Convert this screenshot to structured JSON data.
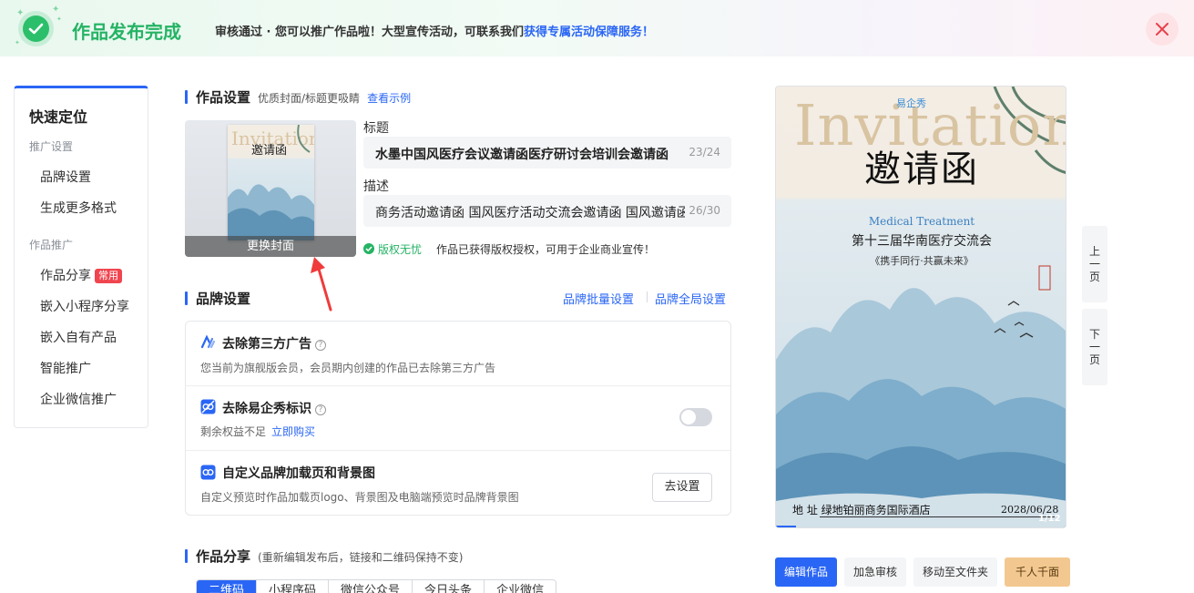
{
  "banner": {
    "title": "作品发布完成",
    "message": "审核通过 · 您可以推广作品啦！大型宣传活动，可联系我们",
    "message_link": "获得专属活动保障服务！"
  },
  "nav": {
    "title": "快速定位",
    "group1": "推广设置",
    "item_brand": "品牌设置",
    "item_formats": "生成更多格式",
    "group2": "作品推广",
    "item_share": "作品分享",
    "item_share_badge": "常用",
    "item_miniapp": "嵌入小程序分享",
    "item_own": "嵌入自有产品",
    "item_smart": "智能推广",
    "item_wecom": "企业微信推广"
  },
  "work_settings": {
    "heading": "作品设置",
    "note": "优质封面/标题更吸睛",
    "example_link": "查看示例",
    "change_cover": "更换封面",
    "title_label": "标题",
    "title_value": "水墨中国风医疗会议邀请函医疗研讨会培训会邀请函",
    "title_count": "23/24",
    "desc_label": "描述",
    "desc_value": "商务活动邀请函 国风医疗活动交流会邀请函 国风邀请函",
    "desc_count": "26/30",
    "copyright_ok": "版权无忧",
    "copyright_text": "作品已获得版权授权，可用于企业商业宣传！"
  },
  "brand": {
    "heading": "品牌设置",
    "batch_link": "品牌批量设置",
    "global_link": "品牌全局设置",
    "opt1_title": "去除第三方广告",
    "opt1_desc": "您当前为旗舰版会员，会员期内创建的作品已去除第三方广告",
    "opt2_title": "去除易企秀标识",
    "opt2_desc": "剩余权益不足",
    "opt2_buy": "立即购买",
    "opt2_enabled": false,
    "opt3_title": "自定义品牌加载页和背景图",
    "opt3_desc": "自定义预览时作品加载页logo、背景图及电脑端预览时品牌背景图",
    "opt3_button": "去设置"
  },
  "share": {
    "heading": "作品分享",
    "note": "(重新编辑发布后，链接和二维码保持不变)",
    "tabs": [
      "二维码",
      "小程序码",
      "微信公众号",
      "今日头条",
      "企业微信"
    ]
  },
  "preview": {
    "logo": "易企秀",
    "invitation_en": "Invitation",
    "title": "邀请函",
    "en_sub": "Medical Treatment",
    "conference": "第十三届华南医疗交流会",
    "slogan": "《携手同行·共赢未来》",
    "address": "地 址 绿地铂丽商务国际酒店",
    "date": "2028/06/28",
    "page": "1/12",
    "prev": [
      "上",
      "一",
      "页"
    ],
    "next": [
      "下",
      "一",
      "页"
    ]
  },
  "actions": {
    "edit": "编辑作品",
    "urgent": "加急审核",
    "move": "移动至文件夹",
    "personalize": "千人千面"
  },
  "colors": {
    "accent": "#2a66f5",
    "success": "#25b364",
    "danger": "#f0454f"
  }
}
